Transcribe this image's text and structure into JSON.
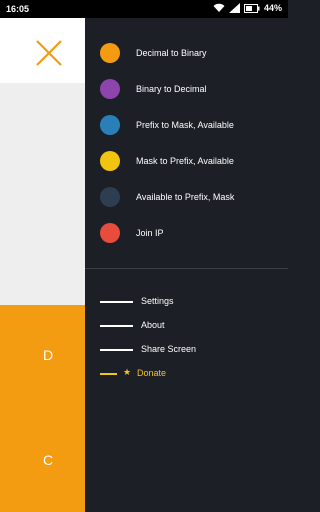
{
  "status": {
    "time": "16:05",
    "battery": "44%"
  },
  "left_pane": {
    "key_d": "D",
    "key_c": "C"
  },
  "menu": {
    "items": [
      {
        "label": "Decimal to Binary",
        "color": "#f39c12"
      },
      {
        "label": "Binary to Decimal",
        "color": "#8e44ad"
      },
      {
        "label": "Prefix to Mask, Available",
        "color": "#2980b9"
      },
      {
        "label": "Mask to Prefix, Available",
        "color": "#f1c40f"
      },
      {
        "label": "Available to Prefix, Mask",
        "color": "#2c3e50"
      },
      {
        "label": "Join IP",
        "color": "#e74c3c"
      }
    ]
  },
  "secondary": {
    "settings": "Settings",
    "about": "About",
    "share": "Share Screen",
    "donate": "Donate"
  },
  "colors": {
    "accent": "#f39c12",
    "drawer_bg": "#1c1f25",
    "donate": "#f5c518"
  }
}
